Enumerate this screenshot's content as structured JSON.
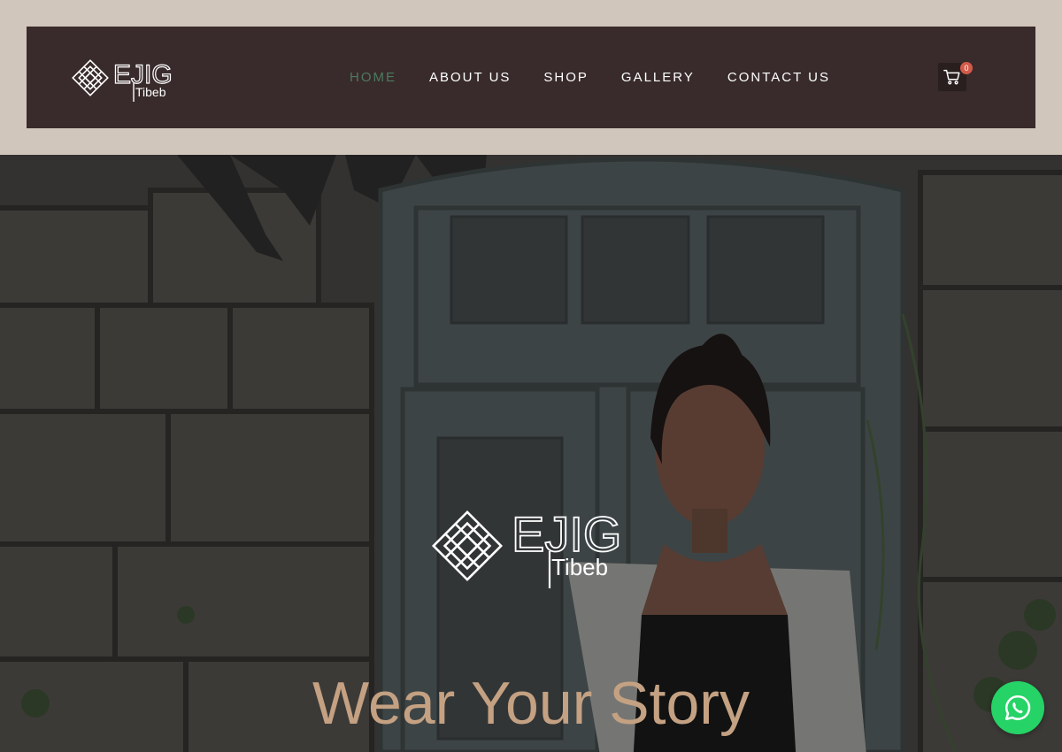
{
  "brand": {
    "logo_text_main": "EJIG",
    "logo_text_sub": "Tibeb",
    "logo_alt": "Ejig Tibeb logo"
  },
  "nav": {
    "items": [
      {
        "label": "HOME",
        "active": true
      },
      {
        "label": "ABOUT US",
        "active": false
      },
      {
        "label": "SHOP",
        "active": false
      },
      {
        "label": "GALLERY",
        "active": false
      },
      {
        "label": "CONTACT US",
        "active": false
      }
    ]
  },
  "cart": {
    "count": "0",
    "icon": "cart-icon"
  },
  "hero": {
    "title": "Wear Your Story",
    "title_color": "#c4a182"
  },
  "floating": {
    "whatsapp_icon": "whatsapp-icon"
  },
  "colors": {
    "header_bg": "#392b2b",
    "page_bg": "#d1c6bc",
    "nav_active": "#4d7a5f",
    "badge": "#d35a4a",
    "whatsapp": "#25d366"
  }
}
